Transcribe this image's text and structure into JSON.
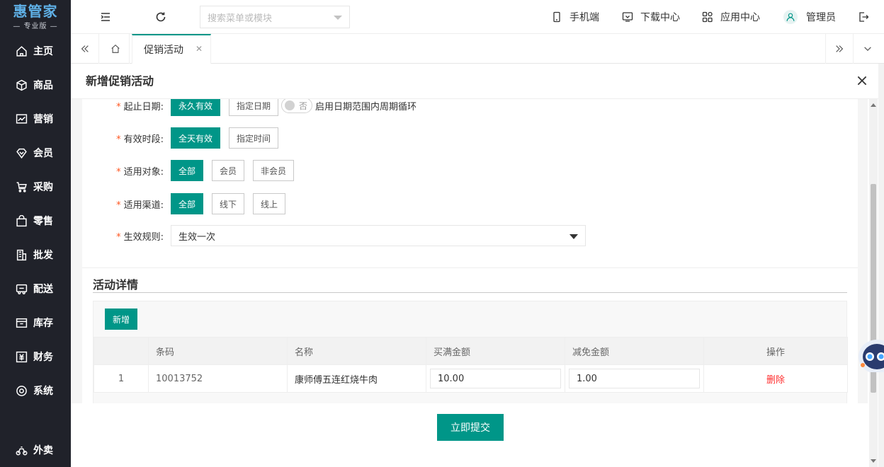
{
  "brand": {
    "title": "惠管家",
    "subtitle": "— 专业版 —"
  },
  "sidebar": {
    "items": [
      {
        "label": "主页",
        "icon": "home-icon"
      },
      {
        "label": "商品",
        "icon": "box-icon"
      },
      {
        "label": "营销",
        "icon": "chart-icon"
      },
      {
        "label": "会员",
        "icon": "member-icon"
      },
      {
        "label": "采购",
        "icon": "purchase-icon"
      },
      {
        "label": "零售",
        "icon": "bag-icon"
      },
      {
        "label": "批发",
        "icon": "building-icon"
      },
      {
        "label": "配送",
        "icon": "truck-icon"
      },
      {
        "label": "库存",
        "icon": "inventory-icon"
      },
      {
        "label": "财务",
        "icon": "finance-icon"
      },
      {
        "label": "系统",
        "icon": "system-icon"
      }
    ],
    "bottom": {
      "label": "外卖",
      "icon": "bike-icon"
    }
  },
  "header": {
    "search_placeholder": "搜索菜单或模块",
    "mobile": "手机端",
    "download": "下载中心",
    "apps": "应用中心",
    "user": "管理员"
  },
  "tabs": {
    "active": "促销活动"
  },
  "dialog": {
    "title": "新增促销活动",
    "form": {
      "date": {
        "label": "起止日期:",
        "options": [
          "永久有效",
          "指定日期"
        ],
        "switch_text": "否",
        "switch_label": "启用日期范围内周期循环"
      },
      "period": {
        "label": "有效时段:",
        "options": [
          "全天有效",
          "指定时间"
        ]
      },
      "target": {
        "label": "适用对象:",
        "options": [
          "全部",
          "会员",
          "非会员"
        ]
      },
      "channel": {
        "label": "适用渠道:",
        "options": [
          "全部",
          "线下",
          "线上"
        ]
      },
      "rule": {
        "label": "生效规则:",
        "value": "生效一次"
      }
    },
    "detail": {
      "title": "活动详情",
      "add": "新增",
      "columns": [
        "条码",
        "名称",
        "买满金额",
        "减免金额",
        "操作"
      ],
      "rows": [
        {
          "idx": "1",
          "code": "10013752",
          "name": "康师傅五连红烧牛肉",
          "full": "10.00",
          "minus": "1.00",
          "action": "删除"
        }
      ]
    },
    "submit": "立即提交"
  },
  "colors": {
    "accent": "#009688",
    "sidebar": "#20222a",
    "danger": "#ff2f2f",
    "required": "#ff5722"
  }
}
